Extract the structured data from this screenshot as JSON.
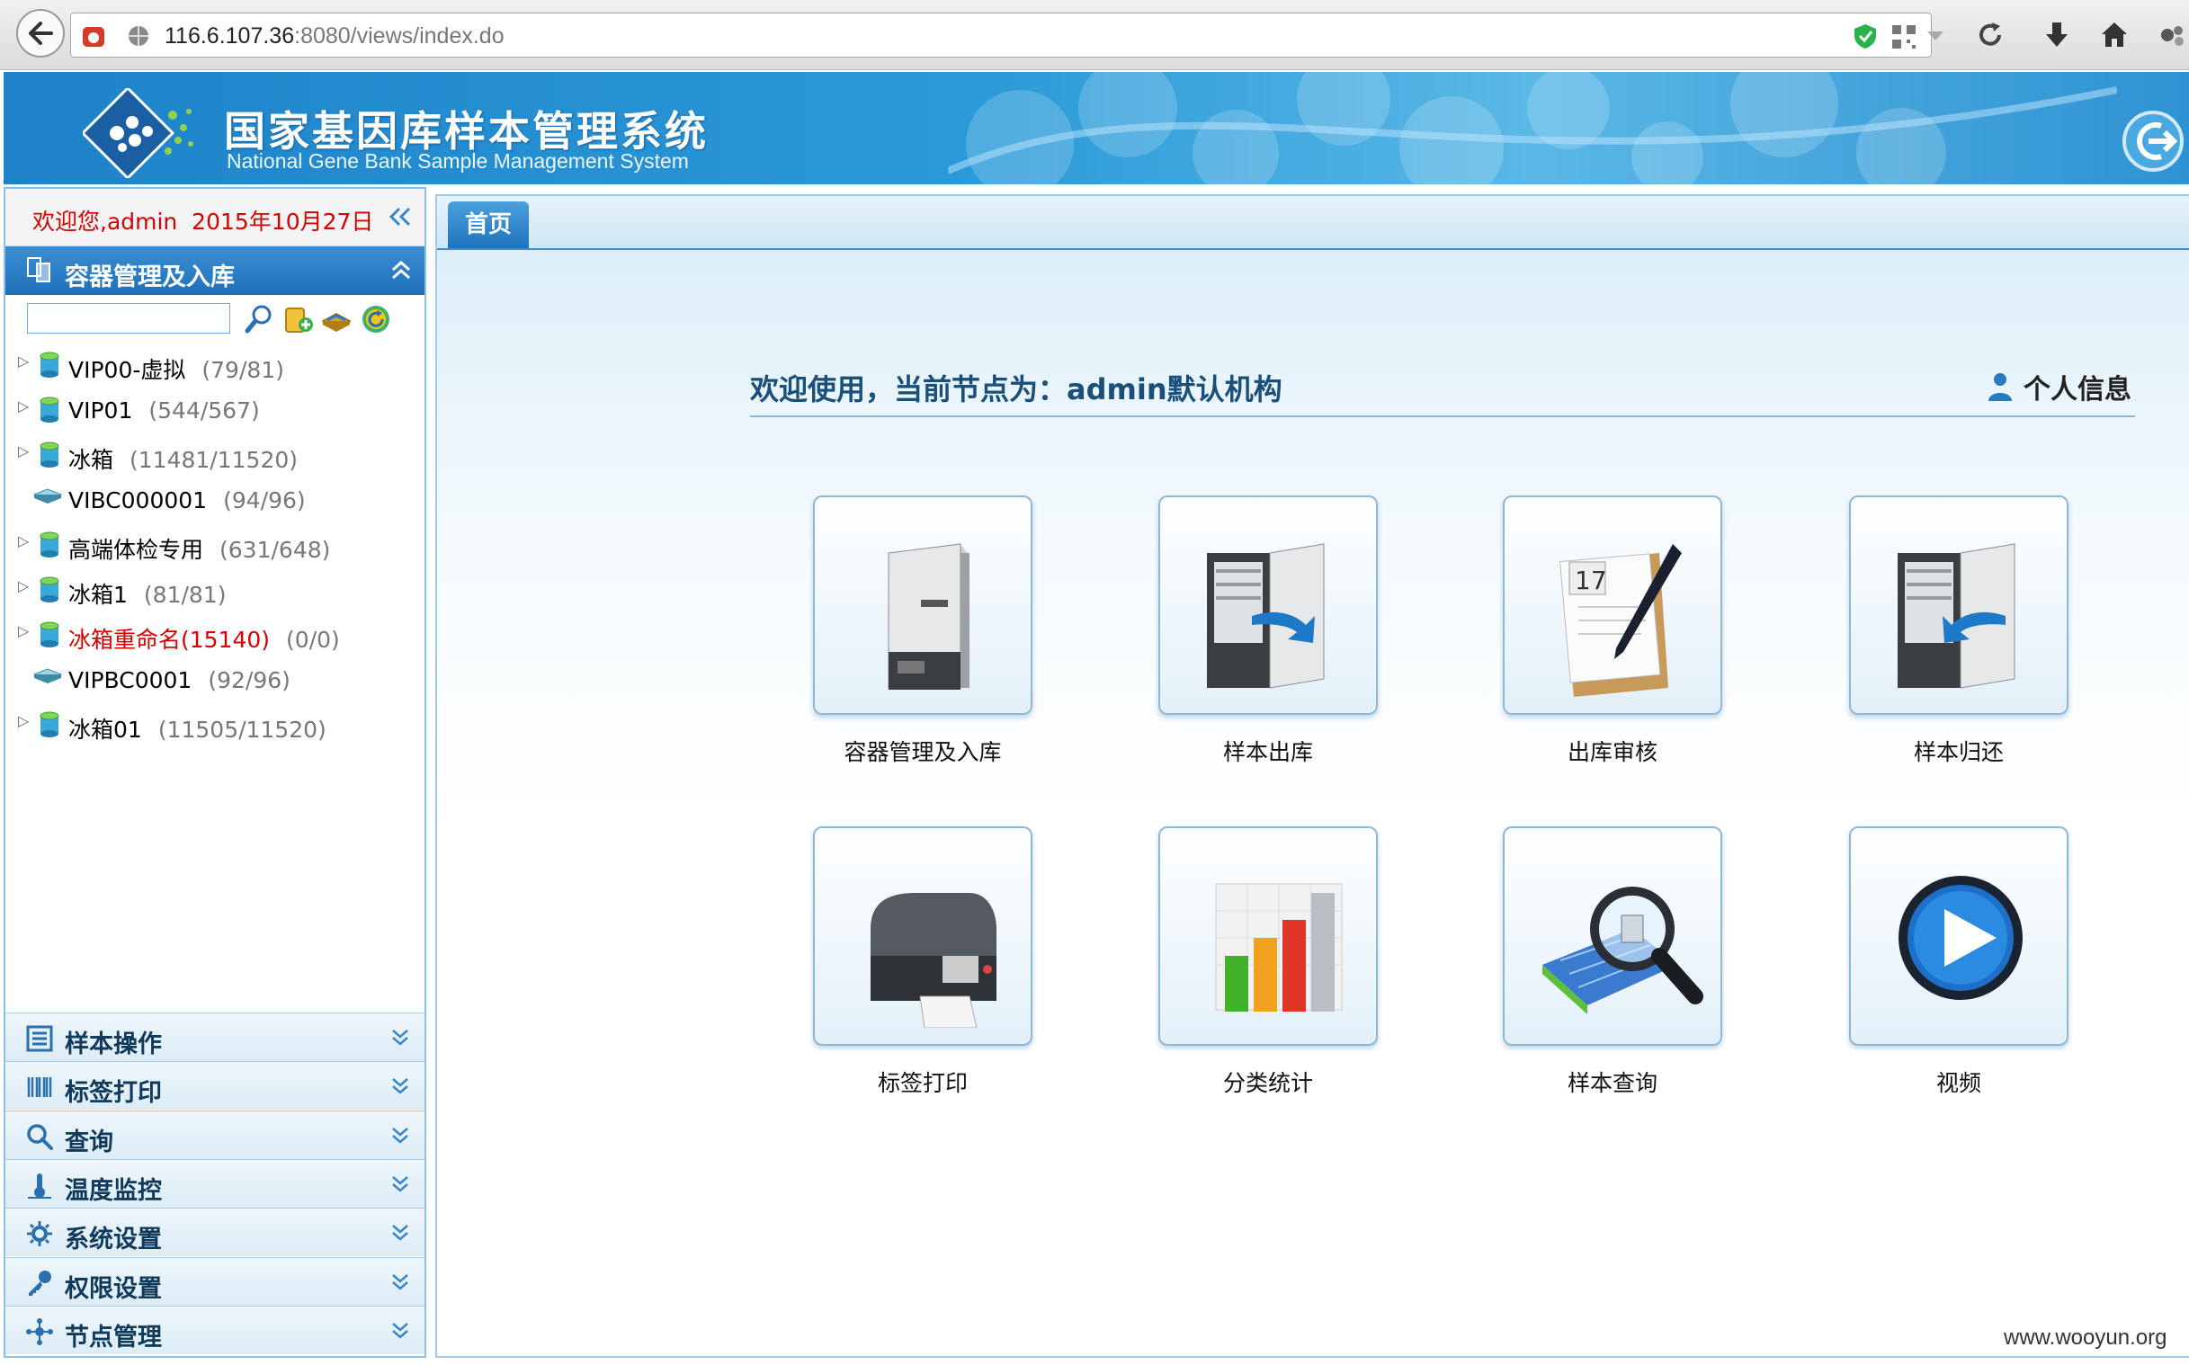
{
  "browser": {
    "url_host": "116.6.107.36",
    "url_rest": ":8080/views/index.do"
  },
  "header": {
    "title": "国家基因库样本管理系统",
    "subtitle": "National Gene Bank Sample Management System"
  },
  "sidebar": {
    "welcome": "欢迎您,admin  2015年10月27日",
    "active_panel": "容器管理及入库",
    "search_value": "",
    "tree": [
      {
        "name": "VIP00-虚拟",
        "count": "(79/81)",
        "expandable": true,
        "icon": "container-icon"
      },
      {
        "name": "VIP01",
        "count": "(544/567)",
        "expandable": true,
        "icon": "container-icon"
      },
      {
        "name": "冰箱",
        "count": "(11481/11520)",
        "expandable": true,
        "icon": "container-icon"
      },
      {
        "name": "VIBC000001",
        "count": "(94/96)",
        "expandable": false,
        "icon": "box-icon"
      },
      {
        "name": "高端体检专用",
        "count": "(631/648)",
        "expandable": true,
        "icon": "container-icon"
      },
      {
        "name": "冰箱1",
        "count": "(81/81)",
        "expandable": true,
        "icon": "container-icon"
      },
      {
        "name": "冰箱重命名(15140)",
        "count": "(0/0)",
        "expandable": true,
        "icon": "container-icon",
        "highlight": "#d40000"
      },
      {
        "name": "VIPBC0001",
        "count": "(92/96)",
        "expandable": false,
        "icon": "box-icon"
      },
      {
        "name": "冰箱01",
        "count": "(11505/11520)",
        "expandable": true,
        "icon": "container-icon"
      }
    ],
    "accordion": [
      {
        "label": "样本操作",
        "icon": "sample-ops-icon"
      },
      {
        "label": "标签打印",
        "icon": "barcode-icon"
      },
      {
        "label": "查询",
        "icon": "search-icon"
      },
      {
        "label": "温度监控",
        "icon": "thermometer-icon"
      },
      {
        "label": "系统设置",
        "icon": "gear-icon"
      },
      {
        "label": "权限设置",
        "icon": "key-icon"
      },
      {
        "label": "节点管理",
        "icon": "nodes-icon"
      }
    ]
  },
  "main": {
    "tab_home": "首页",
    "welcome_heading": "欢迎使用，当前节点为：admin默认机构",
    "personal_info": "个人信息",
    "tiles": [
      {
        "label": "容器管理及入库",
        "icon": "freezer-icon"
      },
      {
        "label": "样本出库",
        "icon": "freezer-out-icon"
      },
      {
        "label": "出库审核",
        "icon": "calendar-pen-icon"
      },
      {
        "label": "样本归还",
        "icon": "freezer-return-icon"
      },
      {
        "label": "标签打印",
        "icon": "label-printer-icon"
      },
      {
        "label": "分类统计",
        "icon": "bar-chart-icon"
      },
      {
        "label": "样本查询",
        "icon": "magnifier-icon"
      },
      {
        "label": "视频",
        "icon": "play-icon"
      }
    ]
  },
  "watermark": "www.wooyun.org",
  "colors": {
    "brand_blue": "#1f6fb8",
    "welcome_red": "#d40000"
  }
}
